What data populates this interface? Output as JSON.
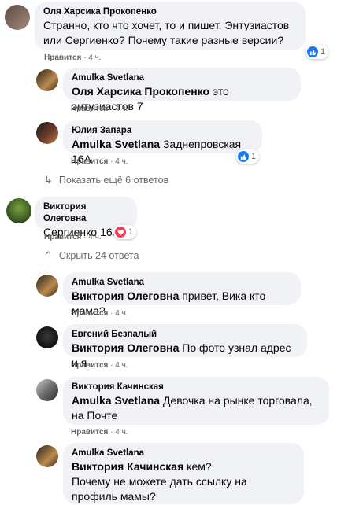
{
  "like_label": "Нравится",
  "comments": [
    {
      "author": "Оля Харсика Прокопенко",
      "text": "Странно, кто что хочет, то и пишет. Энтузиастов или Сергиенко? Почему такие разные версии?",
      "time": "4 ч.",
      "reaction": {
        "type": "like",
        "count": "1",
        "color": "#1877f2"
      }
    },
    {
      "author": "Amulka Svetlana",
      "mention": "Оля Харсика Прокопенко",
      "text": " это энтузиастов 7",
      "time": "4 ч."
    },
    {
      "author": "Юлия Запара",
      "mention": "Amulka Svetlana",
      "text": " Заднепровская 16А",
      "time": "4 ч.",
      "reaction": {
        "type": "like",
        "count": "1",
        "color": "#1877f2"
      }
    },
    {
      "author": "Виктория Олеговна",
      "text": "Сергиенко 16А .",
      "time": "4 ч.",
      "reaction": {
        "type": "love",
        "count": "1",
        "color": "#f33e58"
      }
    },
    {
      "author": "Amulka Svetlana",
      "mention": "Виктория Олеговна",
      "text": " привет, Вика кто мама?",
      "time": "4 ч."
    },
    {
      "author": "Евгений Безпалый",
      "mention": "Виктория Олеговна",
      "text": " По фото узнал адрес и я",
      "time": "4 ч."
    },
    {
      "author": "Виктория Качинская",
      "mention": "Amulka Svetlana",
      "text": " Девочка на рынке торговала, на Почте",
      "time": "4 ч."
    },
    {
      "author": "Amulka Svetlana",
      "mention": "Виктория Качинская",
      "text": " кем?\nПочему не можете дать ссылку на профиль мамы?",
      "time": ""
    }
  ],
  "show_more_replies": "Показать ещё 6 ответов",
  "hide_replies": "Скрыть 24 ответа",
  "icons": {
    "show_more": "reply-arrow-icon",
    "hide": "chevron-up-icon"
  }
}
